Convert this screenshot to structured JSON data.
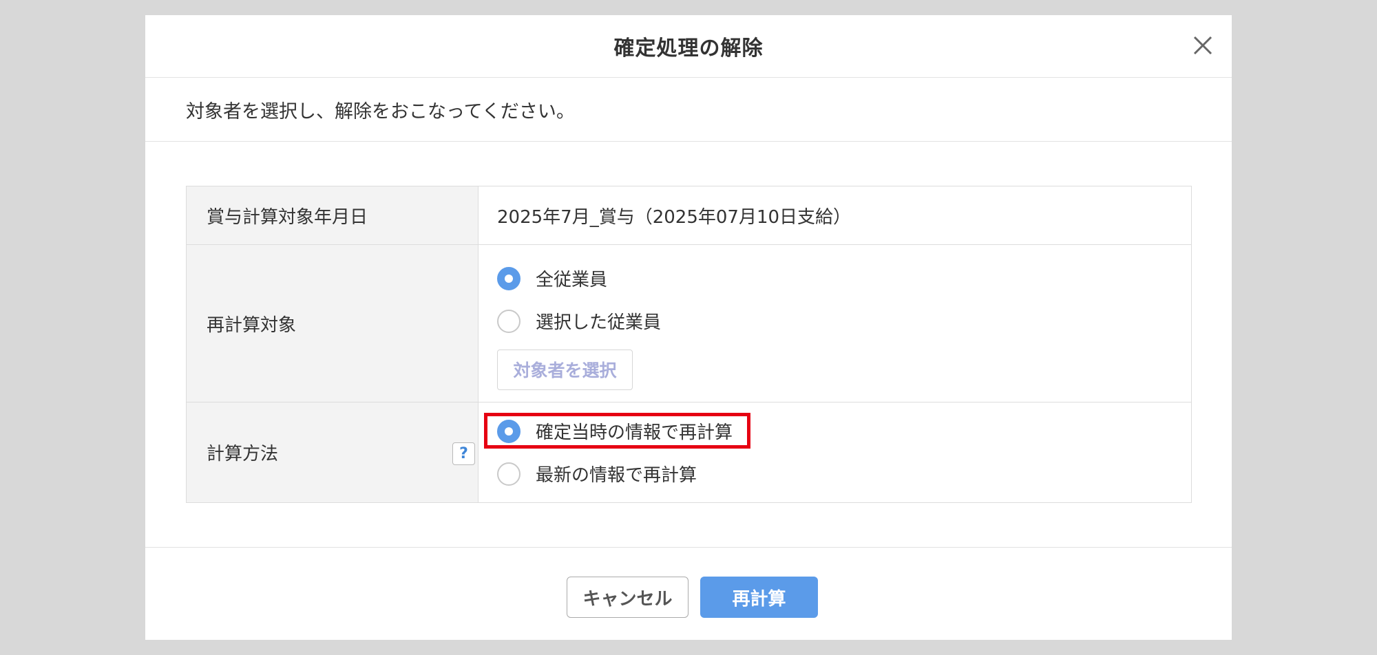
{
  "dialog": {
    "title": "確定処理の解除",
    "description": "対象者を選択し、解除をおこなってください。"
  },
  "form": {
    "bonus_date": {
      "label": "賞与計算対象年月日",
      "value": "2025年7月_賞与（2025年07月10日支給）"
    },
    "recalc_target": {
      "label": "再計算対象",
      "options": [
        {
          "label": "全従業員",
          "checked": true
        },
        {
          "label": "選択した従業員",
          "checked": false
        }
      ],
      "select_button": "対象者を選択"
    },
    "calc_method": {
      "label": "計算方法",
      "help": "?",
      "options": [
        {
          "label": "確定当時の情報で再計算",
          "checked": true
        },
        {
          "label": "最新の情報で再計算",
          "checked": false
        }
      ]
    }
  },
  "footer": {
    "cancel_label": "キャンセル",
    "recalc_label": "再計算"
  },
  "colors": {
    "accent": "#5b9be9",
    "highlight": "#e60012",
    "disabled_text": "#a9aedb"
  }
}
